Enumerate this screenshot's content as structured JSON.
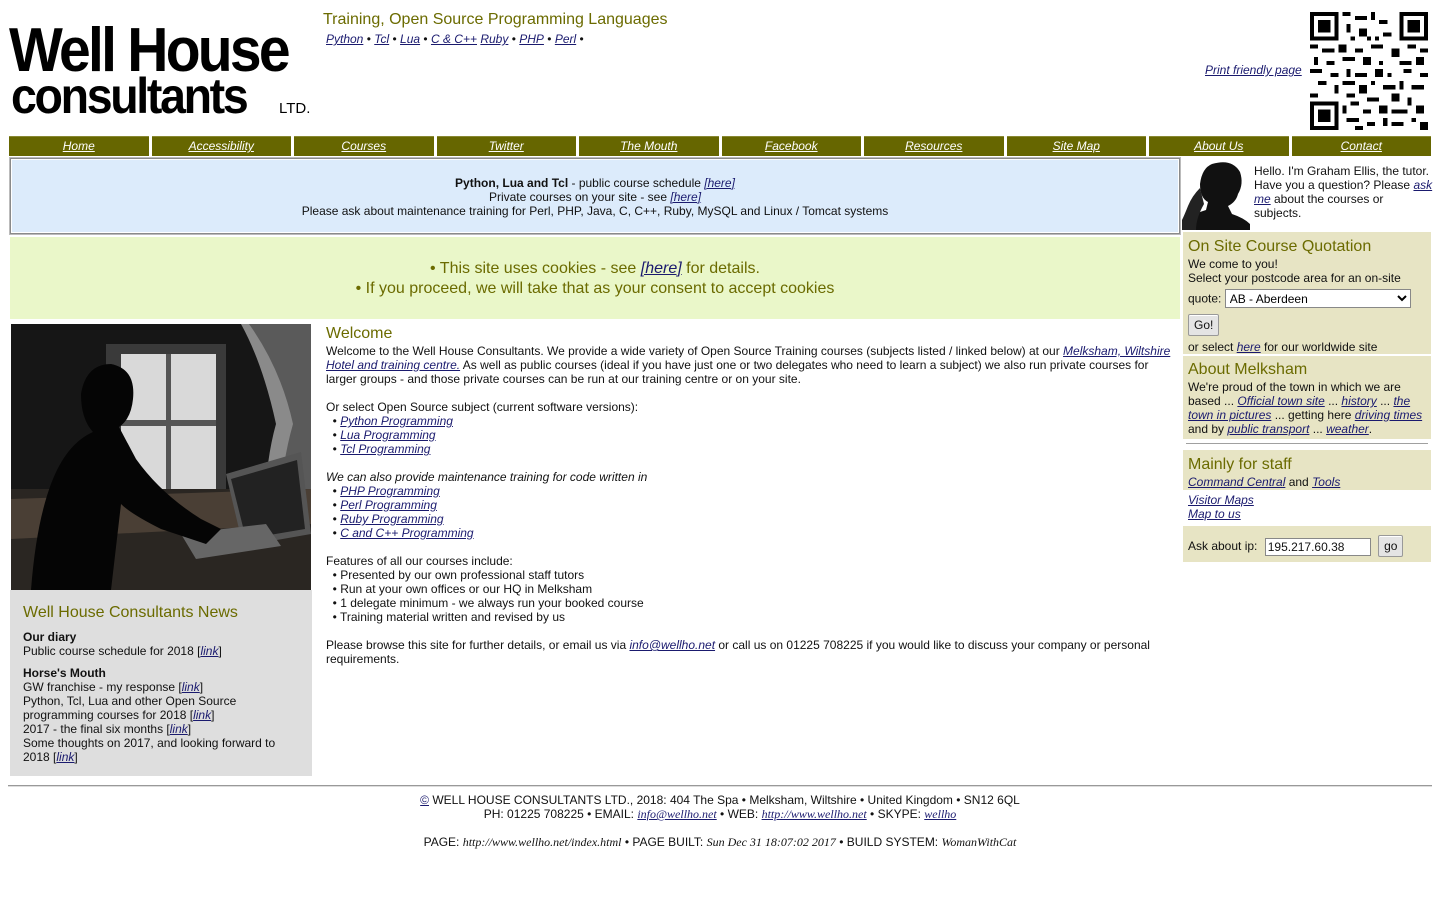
{
  "header": {
    "logo_line1": "Well House",
    "logo_line2": "consultants",
    "logo_ltd": "LTD.",
    "tagline": "Training, Open Source Programming Languages",
    "languages": [
      "Python",
      "Tcl",
      "Lua",
      "C & C++",
      "Ruby",
      "PHP",
      "Perl"
    ],
    "print_link": "Print friendly page"
  },
  "nav": [
    "Home",
    "Accessibility",
    "Courses",
    "Twitter",
    "The Mouth",
    "Facebook",
    "Resources",
    "Site Map",
    "About Us",
    "Contact"
  ],
  "notice": {
    "bold": "Python, Lua and Tcl",
    "line1_rest": " - public course schedule ",
    "here": "[here]",
    "line2": "Private courses on your site - see ",
    "line3": "Please ask about maintenance training for Perl, PHP, Java, C, C++, Ruby, MySQL and Linux / Tomcat systems"
  },
  "cookie": {
    "line1_a": "• This site uses cookies - see ",
    "line1_link": "[here]",
    "line1_b": " for details.",
    "line2": "• If you proceed, we will take that as your consent to accept cookies"
  },
  "news": {
    "title": "Well House Consultants News",
    "diary_heading": "Our diary",
    "diary_item": "Public course schedule for 2018 [",
    "link": "link",
    "mouth_heading": "Horse's Mouth",
    "mouth_items": [
      "GW franchise - my response [",
      "Python, Tcl, Lua and other Open Source programming courses for 2018 [",
      "2017 - the final six months [",
      "Some thoughts on 2017, and looking forward to 2018 ["
    ],
    "close": "]"
  },
  "main": {
    "title": "Welcome",
    "intro_a": "Welcome to the Well House Consultants. We provide a wide variety of Open Source Training courses (subjects listed / linked below) at our ",
    "intro_link": "Melksham, Wiltshire Hotel and training centre.",
    "intro_b": " As well as public courses (ideal if you have just one or two delegates who need to learn a subject) we also run private courses for larger groups - and those private courses can be run at our training centre or on your site.",
    "select_heading": "Or select Open Source subject (current software versions):",
    "subjects": [
      "Python Programming",
      "Lua Programming",
      "Tcl Programming"
    ],
    "maint_heading": "We can also provide maintenance training for code written in",
    "maint": [
      "PHP Programming",
      "Perl Programming",
      "Ruby Programming",
      "C and C++ Programming"
    ],
    "features_heading": "Features of all our courses include:",
    "features": [
      "Presented by our own professional staff tutors",
      "Run at your own offices or our HQ in Melksham",
      "1 delegate minimum - we always run your booked course",
      "Training material written and revised by us"
    ],
    "closing_a": "Please browse this site for further details, or email us via ",
    "closing_email": "info@wellho.net",
    "closing_b": " or call us on 01225 708225 if you would like to discuss your company or personal requirements."
  },
  "tutor": {
    "text_a": "Hello. I'm Graham Ellis, the tutor. Have you a question? Please ",
    "ask_link": "ask me",
    "text_b": " about the courses or subjects."
  },
  "quote": {
    "title": "On Site Course Quotation",
    "line1": "We come to you!",
    "line2": "Select your postcode area for an on-site",
    "label": "quote:",
    "selected": "AB - Aberdeen",
    "go": "Go!",
    "or_a": "or select ",
    "or_link": "here",
    "or_b": " for our worldwide site"
  },
  "about": {
    "title": "About Melksham",
    "a": "We're proud of the town in which we are based ... ",
    "l1": "Official town site",
    "s1": " ... ",
    "l2": "history",
    "s2": " ... ",
    "l3": "the town in pictures",
    "s3": " ... getting here ",
    "l4": "driving times",
    "s4": " and by ",
    "l5": "public transport",
    "s5": " ... ",
    "l6": "weather",
    "end": "."
  },
  "staff": {
    "title": "Mainly for staff",
    "cmd": "Command Central",
    "and": " and ",
    "tools": "Tools",
    "visitor": "Visitor Maps",
    "mapto": "Map to us",
    "ask_label": "Ask about ip:",
    "ip": "195.217.60.38",
    "go": "go"
  },
  "footer": {
    "copy": "©",
    "line1": " WELL HOUSE CONSULTANTS LTD., 2018: 404 The Spa • Melksham, Wiltshire • United Kingdom • SN12 6QL",
    "ph": "PH: 01225 708225 • EMAIL: ",
    "email": "info@wellho.net",
    "web_label": " • WEB: ",
    "web": "http://www.wellho.net",
    "skype_label": " • SKYPE: ",
    "skype": "wellho",
    "page_label": "PAGE: ",
    "page": "http://www.wellho.net/index.html",
    "built_label": " • PAGE BUILT: ",
    "built": "Sun Dec 31 18:07:02 2017",
    "build_sys_label": " • BUILD SYSTEM: ",
    "build_sys": "WomanWithCat"
  }
}
